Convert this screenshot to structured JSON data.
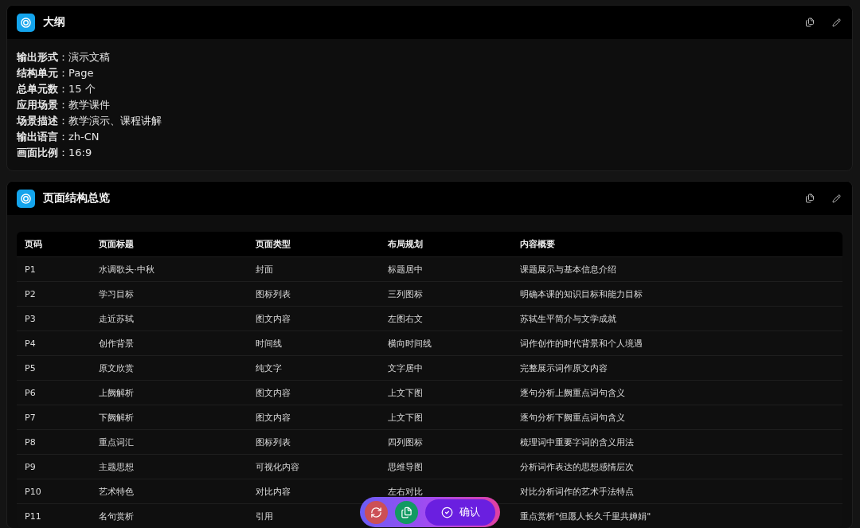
{
  "outline": {
    "title": "大纲",
    "fields": [
      "**输出形式**：演示文稿",
      "**结构单元**：Page",
      "**总单元数**：15 个",
      "**应用场景**：教学课件",
      "**场景描述**：教学演示、课程讲解",
      "**输出语言**：zh-CN",
      "**画面比例**：16:9"
    ]
  },
  "structure": {
    "title": "页面结构总览",
    "table": {
      "columns": [
        "页码",
        "页面标题",
        "页面类型",
        "布局规划",
        "内容概要"
      ],
      "rows": [
        [
          "P1",
          "水调歌头·中秋",
          "封面",
          "标题居中",
          "课题展示与基本信息介绍"
        ],
        [
          "P2",
          "学习目标",
          "图标列表",
          "三列图标",
          "明确本课的知识目标和能力目标"
        ],
        [
          "P3",
          "走近苏轼",
          "图文内容",
          "左图右文",
          "苏轼生平简介与文学成就"
        ],
        [
          "P4",
          "创作背景",
          "时间线",
          "横向时间线",
          "词作创作的时代背景和个人境遇"
        ],
        [
          "P5",
          "原文欣赏",
          "纯文字",
          "文字居中",
          "完整展示词作原文内容"
        ],
        [
          "P6",
          "上阙解析",
          "图文内容",
          "上文下图",
          "逐句分析上阙重点词句含义"
        ],
        [
          "P7",
          "下阙解析",
          "图文内容",
          "上文下图",
          "逐句分析下阙重点词句含义"
        ],
        [
          "P8",
          "重点词汇",
          "图标列表",
          "四列图标",
          "梳理词中重要字词的含义用法"
        ],
        [
          "P9",
          "主题思想",
          "可视化内容",
          "思维导图",
          "分析词作表达的思想感情层次"
        ],
        [
          "P10",
          "艺术特色",
          "对比内容",
          "左右对比",
          "对比分析词作的艺术手法特点"
        ],
        [
          "P11",
          "名句赏析",
          "引用",
          null,
          "重点赏析\"但愿人长久千里共婵娟\""
        ]
      ]
    }
  },
  "action_bar": {
    "confirm_label": "确认"
  }
}
